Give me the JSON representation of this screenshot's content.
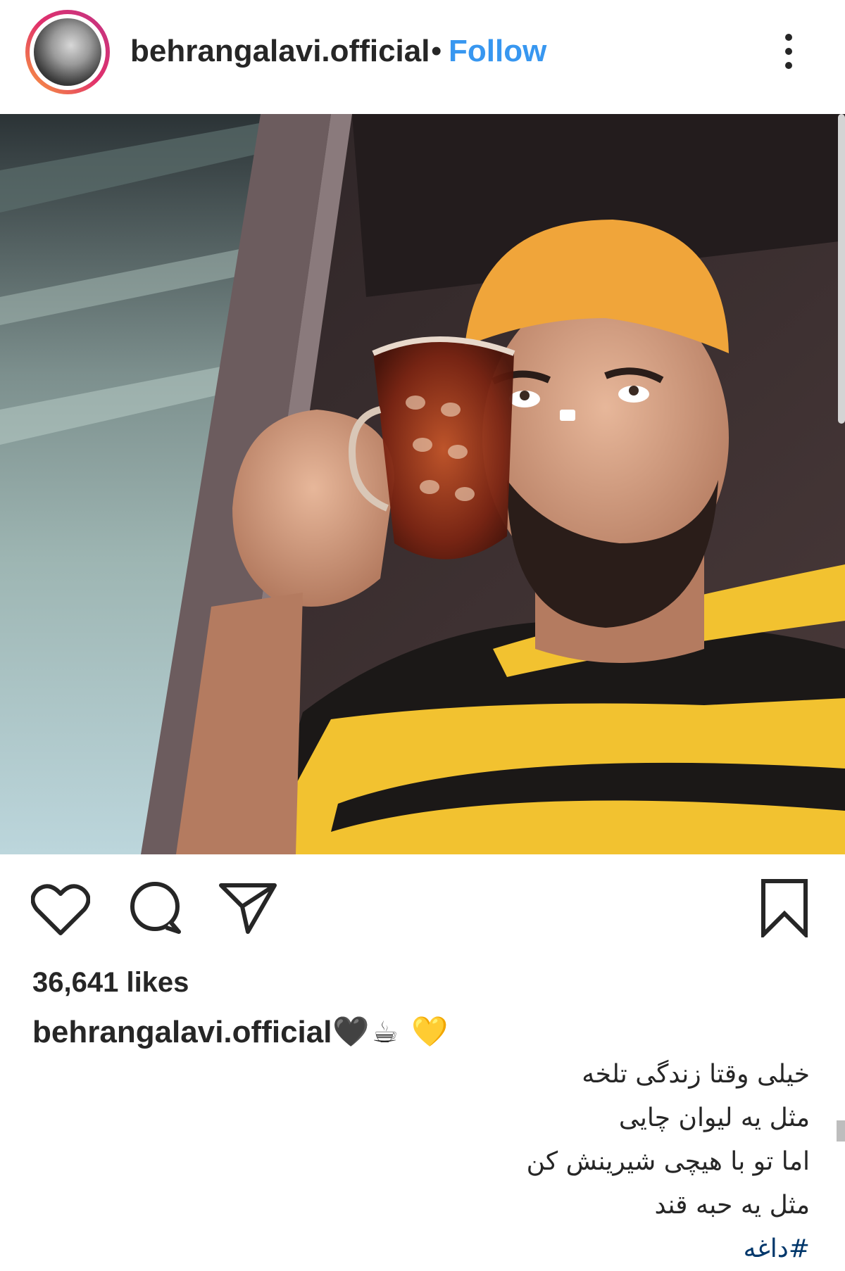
{
  "post": {
    "username": "behrangalavi.official",
    "separator": "•",
    "follow_label": "Follow",
    "more_icon": "more-vertical-icon"
  },
  "actions": {
    "like_icon": "heart-icon",
    "comment_icon": "comment-icon",
    "share_icon": "send-icon",
    "save_icon": "bookmark-icon"
  },
  "likes": "36,641 likes",
  "caption": {
    "username": "behrangalavi.official",
    "emojis": [
      "🖤",
      "☕",
      "💛"
    ],
    "lines": [
      "خیلی وقتا زندگی تلخه",
      "مثل یه لیوان چایی",
      "اما تو با هیچی شیرینش کن",
      "مثل یه حبه قند"
    ],
    "hashtag": "#داغه"
  },
  "colors": {
    "link": "#3897f0",
    "hashtag": "#00376b",
    "beanie": "#f0a53a",
    "shirt_yellow": "#f2c230"
  }
}
